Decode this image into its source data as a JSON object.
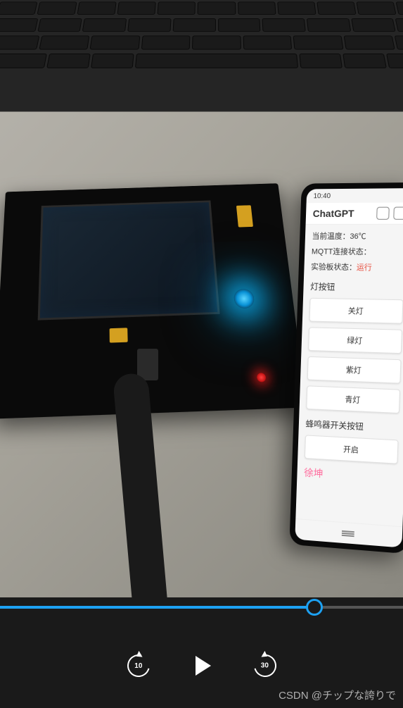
{
  "phone": {
    "time": "10:40",
    "title": "ChatGPT",
    "temperature_label": "当前温度：",
    "temperature_value": "36℃",
    "mqtt_label": "MQTT连接状态：",
    "board_label": "实验板状态：",
    "board_status": "运行",
    "light_section": "灯按钮",
    "buttons": {
      "off": "关灯",
      "green": "绿灯",
      "purple": "紫灯",
      "cyan": "青灯"
    },
    "buzzer_section": "蜂鸣器开关按钮",
    "buzzer_on": "开启",
    "signature": "徐坤"
  },
  "video": {
    "rewind_seconds": "10",
    "forward_seconds": "30",
    "progress_percent": 78
  },
  "watermark": "CSDN @チップな誇りで"
}
